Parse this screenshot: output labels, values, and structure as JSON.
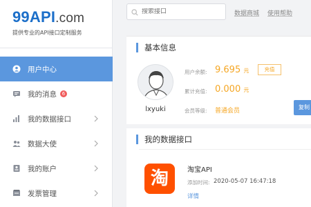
{
  "brand": {
    "logo_main": "99API",
    "logo_suffix": ".com",
    "slogan": "提供专业的API接口定制服务"
  },
  "search": {
    "placeholder": "搜索接口"
  },
  "top_links": [
    "数据商城",
    "使用帮助"
  ],
  "nav": [
    {
      "label": "用户中心",
      "icon": "user-icon",
      "active": true
    },
    {
      "label": "我的消息",
      "icon": "message-icon",
      "badge": "6"
    },
    {
      "label": "我的数据接口",
      "icon": "chart-icon",
      "chevron": true
    },
    {
      "label": "数据大使",
      "icon": "people-icon",
      "chevron": true
    },
    {
      "label": "我的账户",
      "icon": "account-icon",
      "chevron": true
    },
    {
      "label": "发票管理",
      "icon": "invoice-icon",
      "chevron": true
    }
  ],
  "basic_info": {
    "title": "基本信息",
    "username": "lxyuki",
    "balance_label": "用户余额:",
    "balance_value": "9.695",
    "balance_unit": "元",
    "recharge_label": "充值",
    "total_label": "累计充值:",
    "total_value": "0.000",
    "total_unit": "元",
    "level_label": "会员等级:",
    "level_value": "普通会员",
    "side_button": "复制"
  },
  "my_apis": {
    "title": "我的数据接口",
    "items": [
      {
        "icon_char": "淘",
        "name": "淘宝API",
        "time_label": "添加时间:",
        "time": "2020-05-07 16:47:18",
        "detail": "详情"
      }
    ]
  },
  "colors": {
    "accent": "#5b97de",
    "orange": "#f5a623",
    "taobao": "#ff5000",
    "badge": "#f05b5b"
  }
}
